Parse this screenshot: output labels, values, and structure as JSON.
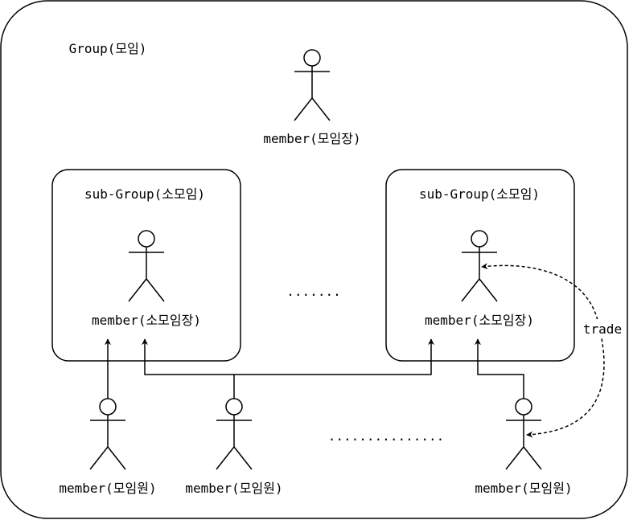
{
  "group": {
    "title": "Group(모임)",
    "leader_label": "member(모임장)"
  },
  "subgroups": [
    {
      "title": "sub-Group(소모임)",
      "leader_label": "member(소모임장)"
    },
    {
      "title": "sub-Group(소모임)",
      "leader_label": "member(소모임장)"
    }
  ],
  "ellipsis_top": ".......",
  "ellipsis_bottom": "...............",
  "members": [
    {
      "label": "member(모임원)"
    },
    {
      "label": "member(모임원)"
    },
    {
      "label": "member(모임원)"
    }
  ],
  "trade_label": "trade",
  "colors": {
    "stroke": "#000000",
    "background": "#ffffff"
  }
}
